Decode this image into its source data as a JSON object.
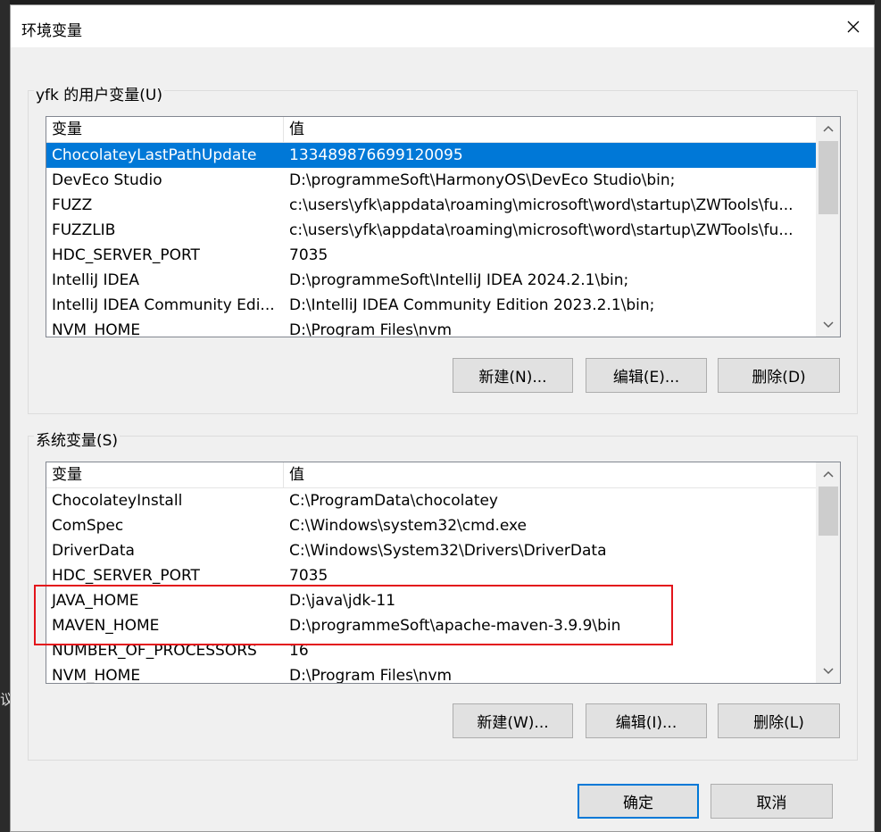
{
  "dialog": {
    "title": "环境变量",
    "close_label": "✕"
  },
  "background": {
    "left_glyph": "议"
  },
  "user_vars": {
    "group_label": "yfk 的用户变量(U)",
    "col_variable": "变量",
    "col_value": "值",
    "rows": [
      {
        "name": "ChocolateyLastPathUpdate",
        "value": "133489876699120095",
        "selected": true
      },
      {
        "name": "DevEco Studio",
        "value": "D:\\programmeSoft\\HarmonyOS\\DevEco Studio\\bin;"
      },
      {
        "name": "FUZZ",
        "value": "c:\\users\\yfk\\appdata\\roaming\\microsoft\\word\\startup\\ZWTools\\fu..."
      },
      {
        "name": "FUZZLIB",
        "value": "c:\\users\\yfk\\appdata\\roaming\\microsoft\\word\\startup\\ZWTools\\fu..."
      },
      {
        "name": "HDC_SERVER_PORT",
        "value": "7035"
      },
      {
        "name": "IntelliJ IDEA",
        "value": "D:\\programmeSoft\\IntelliJ IDEA 2024.2.1\\bin;"
      },
      {
        "name": "IntelliJ IDEA Community Edi...",
        "value": "D:\\IntelliJ IDEA Community Edition 2023.2.1\\bin;"
      },
      {
        "name": "NVM_HOME",
        "value": "D:\\Program Files\\nvm"
      }
    ],
    "buttons": {
      "new": "新建(N)...",
      "edit": "编辑(E)...",
      "delete": "删除(D)"
    }
  },
  "system_vars": {
    "group_label": "系统变量(S)",
    "col_variable": "变量",
    "col_value": "值",
    "rows": [
      {
        "name": "ChocolateyInstall",
        "value": "C:\\ProgramData\\chocolatey"
      },
      {
        "name": "ComSpec",
        "value": "C:\\Windows\\system32\\cmd.exe"
      },
      {
        "name": "DriverData",
        "value": "C:\\Windows\\System32\\Drivers\\DriverData"
      },
      {
        "name": "HDC_SERVER_PORT",
        "value": "7035"
      },
      {
        "name": "JAVA_HOME",
        "value": "D:\\java\\jdk-11"
      },
      {
        "name": "MAVEN_HOME",
        "value": "D:\\programmeSoft\\apache-maven-3.9.9\\bin"
      },
      {
        "name": "NUMBER_OF_PROCESSORS",
        "value": "16"
      },
      {
        "name": "NVM_HOME",
        "value": "D:\\Program Files\\nvm"
      }
    ],
    "buttons": {
      "new": "新建(W)...",
      "edit": "编辑(I)...",
      "delete": "删除(L)"
    }
  },
  "footer": {
    "ok": "确定",
    "cancel": "取消"
  },
  "colors": {
    "selection": "#0078d7",
    "highlight_box": "#e3141b",
    "default_button_border": "#0078d7"
  }
}
